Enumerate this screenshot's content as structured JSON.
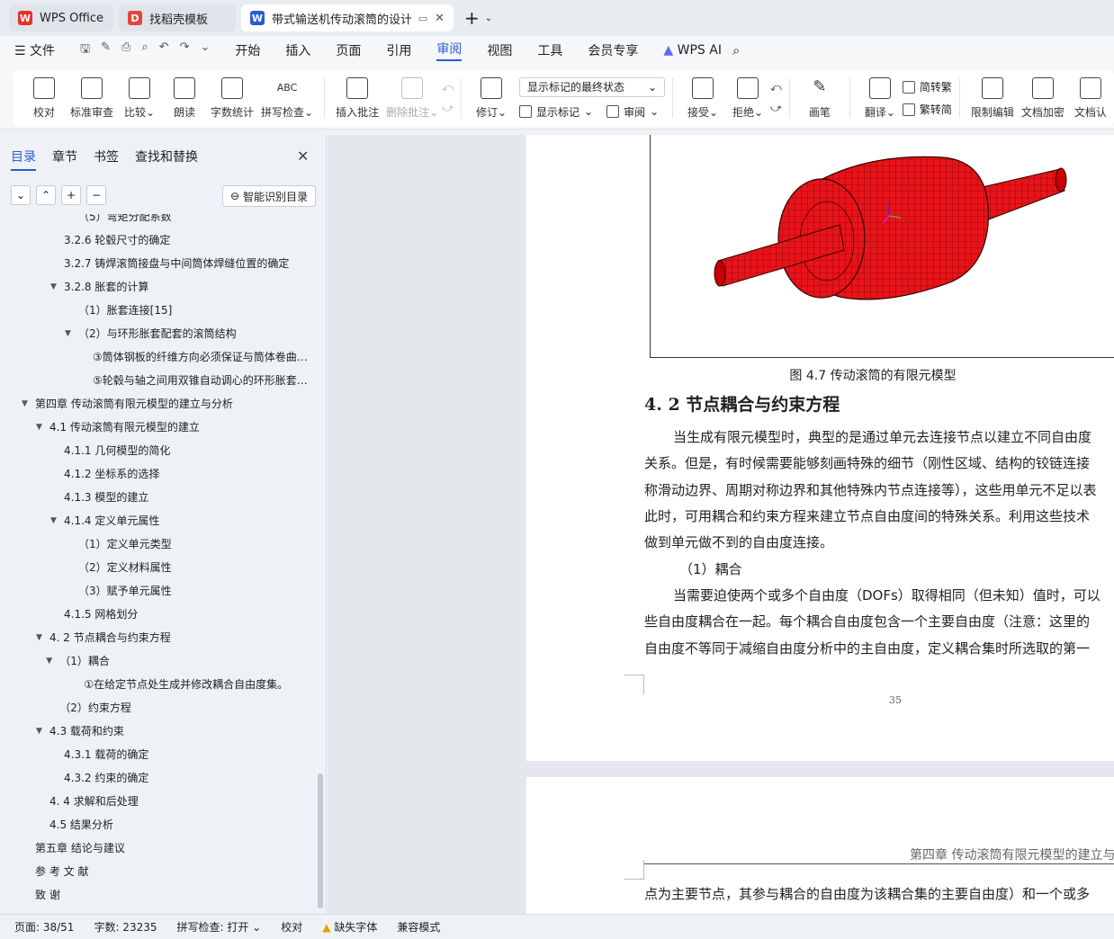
{
  "tabs": [
    {
      "label": "WPS Office"
    },
    {
      "label": "找稻壳模板"
    },
    {
      "label": "带式输送机传动滚筒的设计 说"
    }
  ],
  "menu": {
    "file": "文件",
    "items": [
      "开始",
      "插入",
      "页面",
      "引用",
      "审阅",
      "视图",
      "工具",
      "会员专享"
    ],
    "ai": "WPS AI"
  },
  "ribbon": {
    "proof": "校对",
    "std_review": "标准审查",
    "compare": "比较",
    "read_aloud": "朗读",
    "word_count": "字数统计",
    "spell_check": "拼写检查",
    "insert_comment": "插入批注",
    "delete_comment": "删除批注",
    "track": "修订",
    "display_select": "显示标记的最终状态",
    "show_markup": "显示标记",
    "review": "审阅",
    "accept": "接受",
    "reject": "拒绝",
    "pen": "画笔",
    "translate": "翻译",
    "to_trad": "简转繁",
    "to_simp": "繁转简",
    "restrict": "限制编辑",
    "encrypt": "文档加密",
    "doc_cert": "文档认"
  },
  "sidebar": {
    "tabs": [
      "目录",
      "章节",
      "书签",
      "查找和替换"
    ],
    "smart_btn": "智能识别目录",
    "toc": [
      {
        "t": "（5）弯矩分配系数",
        "l": 3,
        "c": ""
      },
      {
        "t": "3.2.6  轮毂尺寸的确定",
        "l": 2,
        "c": ""
      },
      {
        "t": "3.2.7  铸焊滚筒接盘与中间筒体焊缝位置的确定",
        "l": 2,
        "c": ""
      },
      {
        "t": "3.2.8  胀套的计算",
        "l": 2,
        "c": "▼"
      },
      {
        "t": "（1）胀套连接[15]",
        "l": 3,
        "c": ""
      },
      {
        "t": "（2）与环形胀套配套的滚筒结构",
        "l": 3,
        "c": "▼"
      },
      {
        "t": "③筒体钢板的纤维方向必须保证与筒体卷曲 ...",
        "l": 4,
        "c": ""
      },
      {
        "t": "⑤轮毂与轴之间用双锥自动调心的环形胀套 ...",
        "l": 4,
        "c": ""
      },
      {
        "t": "第四章  传动滚筒有限元模型的建立与分析",
        "l": 0,
        "c": "▼"
      },
      {
        "t": "4.1  传动滚筒有限元模型的建立",
        "l": 1,
        "c": "▼"
      },
      {
        "t": "4.1.1  几何模型的简化",
        "l": 2,
        "c": ""
      },
      {
        "t": "4.1.2  坐标系的选择",
        "l": 2,
        "c": ""
      },
      {
        "t": "4.1.3  模型的建立",
        "l": 2,
        "c": ""
      },
      {
        "t": "4.1.4  定义单元属性",
        "l": 2,
        "c": "▼"
      },
      {
        "t": "（1）定义单元类型",
        "l": 3,
        "c": ""
      },
      {
        "t": "（2）定义材料属性",
        "l": 3,
        "c": ""
      },
      {
        "t": "（3）赋予单元属性",
        "l": 3,
        "c": ""
      },
      {
        "t": "4.1.5  网格划分",
        "l": 2,
        "c": ""
      },
      {
        "t": "4. 2  节点耦合与约束方程",
        "l": 1,
        "c": "▼"
      },
      {
        "t": "（1）耦合",
        "l": 1.7,
        "c": "▼"
      },
      {
        "t": "①在给定节点处生成并修改耦合自由度集。",
        "l": 3.4,
        "c": ""
      },
      {
        "t": "（2）约束方程",
        "l": 1.7,
        "c": ""
      },
      {
        "t": "4.3  载荷和约束",
        "l": 1,
        "c": "▼"
      },
      {
        "t": "4.3.1  载荷的确定",
        "l": 2,
        "c": ""
      },
      {
        "t": "4.3.2  约束的确定",
        "l": 2,
        "c": ""
      },
      {
        "t": "4. 4  求解和后处理",
        "l": 1,
        "c": ""
      },
      {
        "t": "4.5  结果分析",
        "l": 1,
        "c": ""
      },
      {
        "t": "第五章  结论与建议",
        "l": 0,
        "c": ""
      },
      {
        "t": "参 考 文 献",
        "l": 0,
        "c": ""
      },
      {
        "t": "致    谢",
        "l": 0,
        "c": ""
      }
    ]
  },
  "doc": {
    "caption": "图 4.7 传动滚筒的有限元模型",
    "heading": "4. 2  节点耦合与约束方程",
    "lines": [
      "当生成有限元模型时，典型的是通过单元去连接节点以建立不同自由度",
      "关系。但是，有时候需要能够刻画特殊的细节（刚性区域、结构的铰链连接",
      "称滑动边界、周期对称边界和其他特殊内节点连接等），这些用单元不足以表",
      "此时，可用耦合和约束方程来建立节点自由度间的特殊关系。利用这些技术",
      "做到单元做不到的自由度连接。",
      "（1）耦合",
      "当需要迫使两个或多个自由度（DOFs）取得相同（但未知）值时，可以",
      "些自由度耦合在一起。每个耦合自由度包含一个主要自由度（注意：这里的",
      "自由度不等同于减缩自由度分析中的主自由度，定义耦合集时所选取的第一"
    ],
    "page_number": "35",
    "header2": "第四章  传动滚筒有限元模型的建立与",
    "p2_line": "点为主要节点，其参与耦合的自由度为该耦合集的主要自由度）和一个或多"
  },
  "status": {
    "page": "页面: 38/51",
    "words": "字数: 23235",
    "spell": "拼写检查: 打开",
    "proof": "校对",
    "missing_font": "缺失字体",
    "compat": "兼容模式"
  },
  "colors": {
    "accent": "#2a5bd7",
    "mesh_red": "#e8141a"
  }
}
